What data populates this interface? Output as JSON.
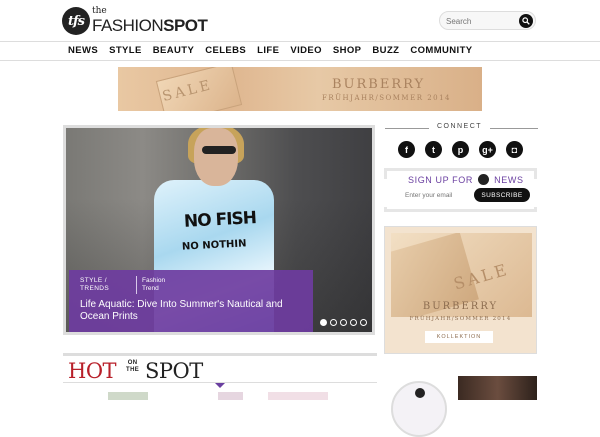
{
  "header": {
    "logo_mark": "tfs",
    "logo_the": "the",
    "logo_name_part1": "FASHION",
    "logo_name_part2": "SPOT",
    "search_placeholder": "Search"
  },
  "nav": {
    "items": [
      "NEWS",
      "STYLE",
      "BEAUTY",
      "CELEBS",
      "LIFE",
      "VIDEO",
      "SHOP",
      "BUZZ",
      "COMMUNITY"
    ]
  },
  "top_banner": {
    "sale_word": "SALE",
    "brand": "BURBERRY",
    "season": "FRÜHJAHR/SOMMER 2014"
  },
  "feature": {
    "print_text_1": "NO FISH",
    "print_text_2": "NO NOTHIN",
    "category": "STYLE /\nTRENDS",
    "tag": "Fashion\nTrend",
    "title": "Life Aquatic: Dive Into Summer's Nautical and Ocean Prints",
    "slides_total": 5,
    "active_slide": 1
  },
  "connect": {
    "title": "CONNECT",
    "social": [
      "facebook-icon",
      "twitter-icon",
      "pinterest-icon",
      "google-plus-icon",
      "instagram-icon"
    ]
  },
  "signup": {
    "title_before": "SIGN UP FOR",
    "title_after": "NEWS",
    "email_placeholder": "Enter your email",
    "button_label": "SUBSCRIBE"
  },
  "side_ad": {
    "sale_word": "SALE",
    "brand": "BURBERRY",
    "season": "FRÜHJAHR/SOMMER 2014",
    "button_label": "KOLLEKTION"
  },
  "hot_section": {
    "word_hot": "HOT",
    "word_on_the": "ON\nTHE",
    "word_spot": "SPOT"
  },
  "colors": {
    "accent_purple": "#6a3fa0",
    "hot_red": "#b8202a",
    "dark": "#111111"
  }
}
